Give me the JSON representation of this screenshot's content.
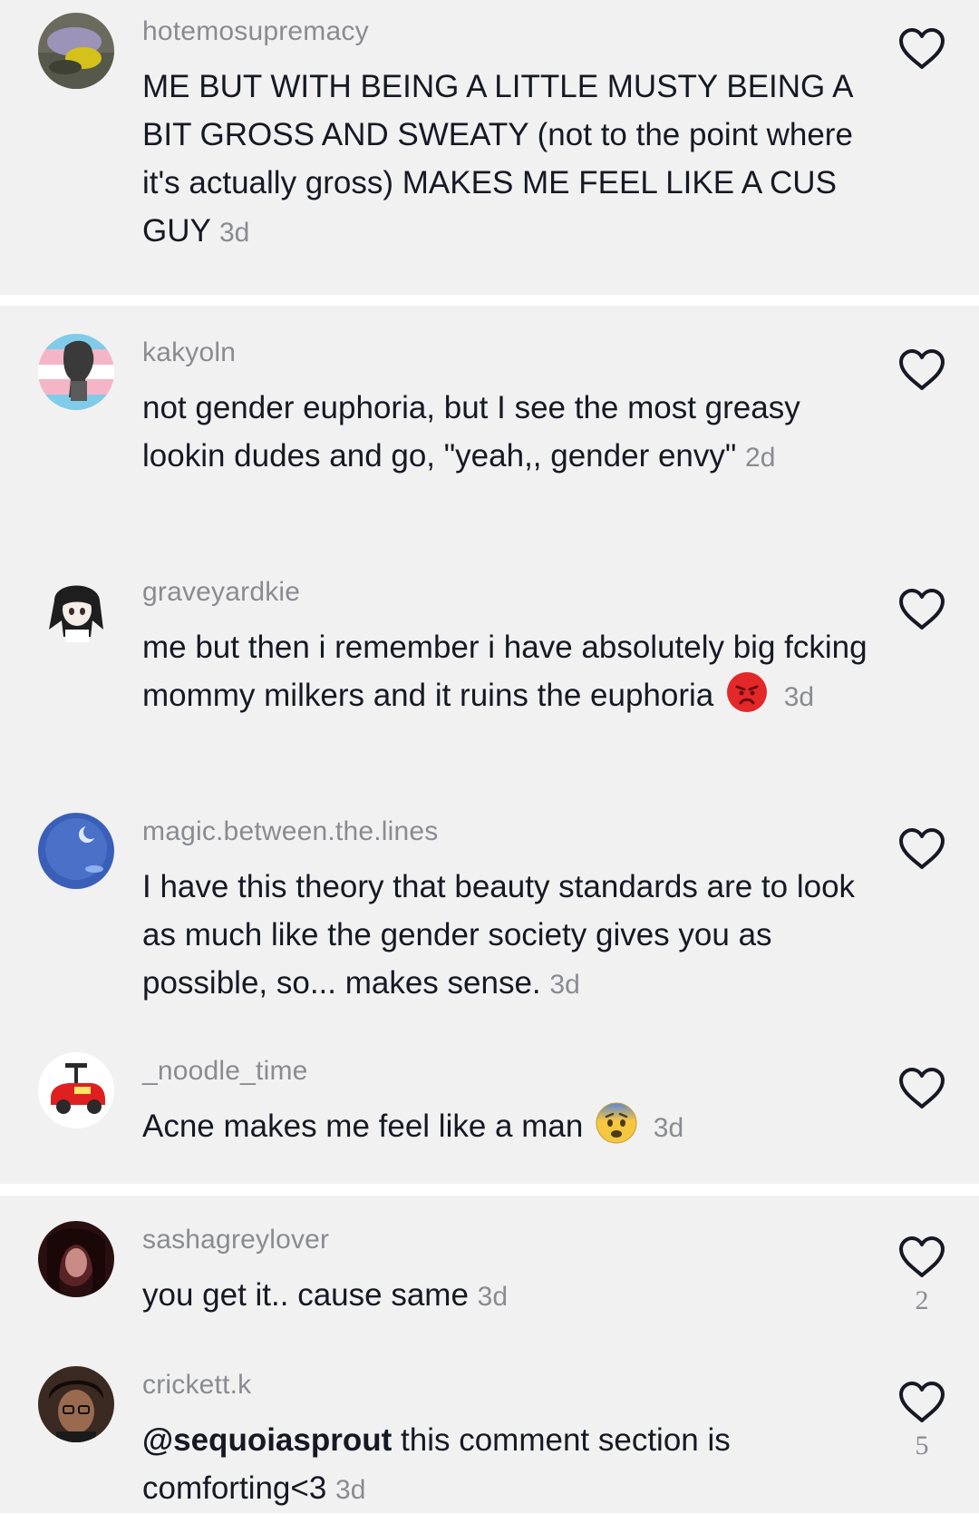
{
  "comments": [
    {
      "username": "hotemosupremacy",
      "text": "ME BUT WITH BEING A LITTLE MUSTY BEING A BIT GROSS AND SWEATY (not to the point where it's actually gross) MAKES ME FEEL LIKE A CUS GUY",
      "age": "3d",
      "likes": ""
    },
    {
      "username": "kakyoln",
      "text": "not gender euphoria, but I see the most greasy lookin dudes and go, \"yeah,, gender envy\"",
      "age": "2d",
      "likes": ""
    },
    {
      "username": "graveyardkie",
      "text": "me but then i remember i have absolutely big fcking mommy milkers and it ruins the euphoria",
      "emoji": "angry-face-emoji",
      "age": "3d",
      "likes": ""
    },
    {
      "username": "magic.between.the.lines",
      "text": "I have this theory that beauty standards are to look as much like the gender society gives you as possible, so... makes sense.",
      "age": "3d",
      "likes": ""
    },
    {
      "username": "_noodle_time",
      "text": "Acne makes me feel like a man",
      "emoji": "anxious-face-emoji",
      "age": "3d",
      "likes": ""
    },
    {
      "username": "sashagreylover",
      "text": "you get it.. cause same",
      "age": "3d",
      "likes": "2"
    },
    {
      "username": "crickett.k",
      "mention": "@sequoiasprout",
      "text": "this comment section is comforting<3",
      "age": "3d",
      "likes": "5"
    }
  ],
  "icons": {
    "like": "heart-outline-icon"
  },
  "colors": {
    "panel_background": "#f1f1f2",
    "divider": "#ffffff",
    "username": "#8a8b91",
    "text": "#161823",
    "angry_emoji": "#e3282a",
    "anxious_emoji": "#f7c640"
  }
}
